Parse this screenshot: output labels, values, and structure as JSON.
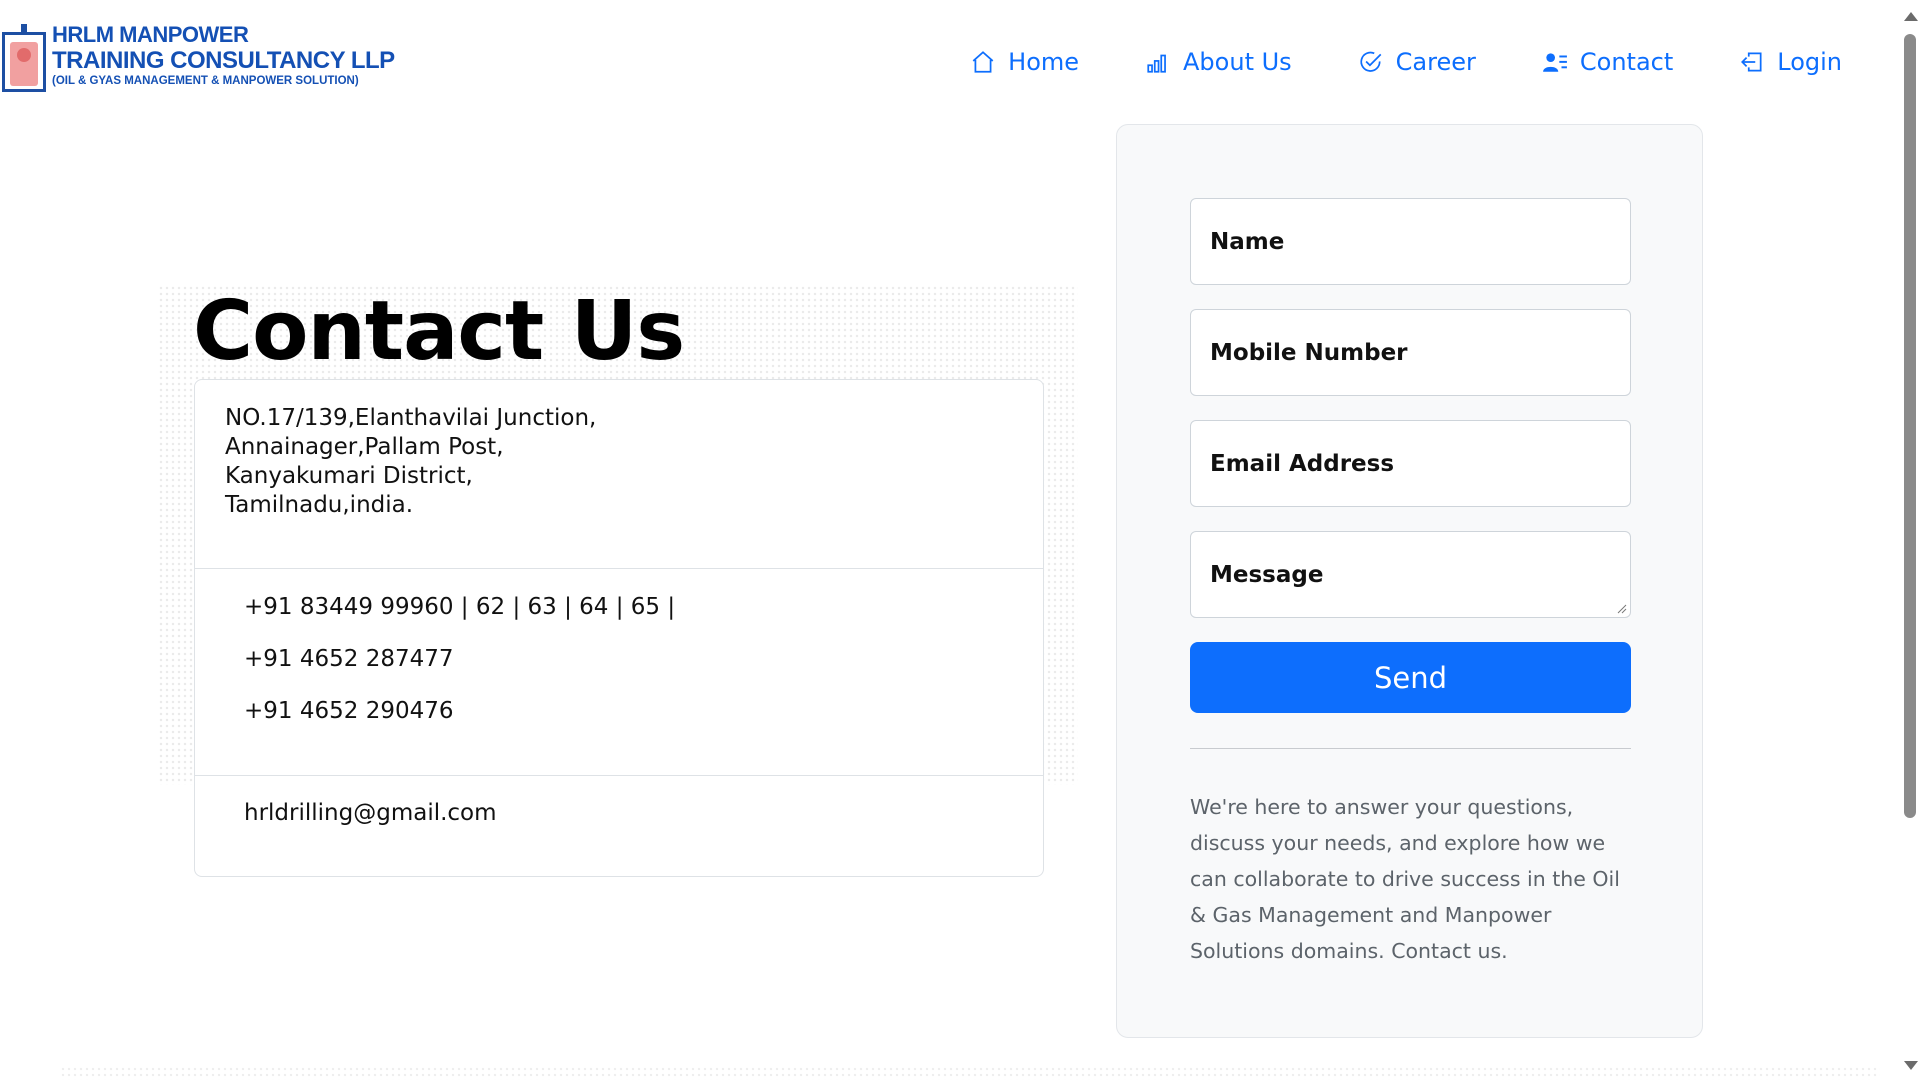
{
  "brand": {
    "line1": "HRLM MANPOWER",
    "line2": "TRAINING CONSULTANCY LLP",
    "line3": "(OIL & GYAS MANAGEMENT & MANPOWER SOLUTION)"
  },
  "nav": {
    "items": [
      {
        "label": "Home",
        "icon": "home-icon"
      },
      {
        "label": "About Us",
        "icon": "bar-chart-icon"
      },
      {
        "label": "Career",
        "icon": "check-circle-icon"
      },
      {
        "label": "Contact",
        "icon": "person-lines-icon"
      },
      {
        "label": "Login",
        "icon": "login-icon"
      }
    ]
  },
  "main": {
    "title": "Contact Us",
    "address": [
      "NO.17/139,Elanthavilai Junction,",
      "Annainager,Pallam Post,",
      "Kanyakumari District,",
      "Tamilnadu,india."
    ],
    "phones": [
      "+91 83449 99960 | 62 | 63 | 64 | 65 |",
      "+91 4652 287477",
      "+91 4652 290476"
    ],
    "email": "hrldrilling@gmail.com"
  },
  "form": {
    "name_placeholder": "Name",
    "mobile_placeholder": "Mobile Number",
    "email_placeholder": "Email Address",
    "message_placeholder": "Message",
    "send_label": "Send",
    "blurb": "We're here to answer your questions, discuss your needs, and explore how we can collaborate to drive success in the Oil & Gas Management and Manpower Solutions domains. Contact us."
  },
  "colors": {
    "accent": "#0d6efd",
    "brand": "#1450b4",
    "panel_bg": "#f8f9fa"
  }
}
